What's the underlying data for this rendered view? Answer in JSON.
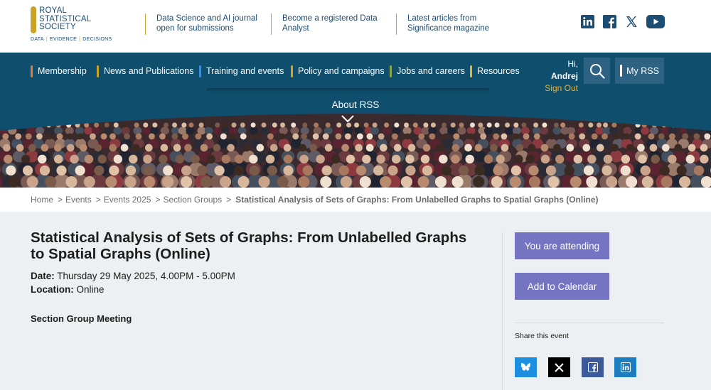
{
  "logo": {
    "lines": [
      "ROYAL",
      "STATISTICAL",
      "SOCIETY"
    ],
    "tagline": [
      "DATA",
      "EVIDENCE",
      "DECISIONS"
    ]
  },
  "promos": [
    {
      "line1": "Data Science and AI journal",
      "line2": "open for submissions"
    },
    {
      "line1": "Become a registered Data",
      "line2": "Analyst"
    },
    {
      "line1": "Latest articles from",
      "line2": "Significance magazine"
    }
  ],
  "social_top": [
    "linkedin-icon",
    "facebook-icon",
    "x-icon",
    "youtube-icon"
  ],
  "nav": {
    "items": [
      {
        "label": "Membership",
        "color": "#e07b39"
      },
      {
        "label": "News and Publications",
        "color": "#c9a227"
      },
      {
        "label": "Training and events",
        "color": "#3a8fd8"
      },
      {
        "label": "Policy and campaigns",
        "color": "#d4a22a"
      },
      {
        "label": "Jobs and careers",
        "color": "#8aa64a"
      },
      {
        "label": "Resources",
        "color": "#e0b33a"
      }
    ],
    "greeting": "Hi,",
    "user_name": "Andrej",
    "sign_out": "Sign Out",
    "my_rss": "My RSS"
  },
  "hero": {
    "about_label": "About RSS"
  },
  "breadcrumb": {
    "items": [
      "Home",
      "Events",
      "Events 2025",
      "Section Groups"
    ],
    "current": "Statistical Analysis of Sets of Graphs: From Unlabelled Graphs to Spatial Graphs (Online)"
  },
  "event": {
    "title": "Statistical Analysis of Sets of Graphs: From Unlabelled Graphs to Spatial Graphs (Online)",
    "date_label": "Date:",
    "date_value": "Thursday 29 May 2025, 4.00PM - 5.00PM",
    "location_label": "Location:",
    "location_value": "Online",
    "type": "Section Group Meeting"
  },
  "sidebar": {
    "attending_label": "You are attending",
    "calendar_label": "Add to Calendar",
    "share_label": "Share this event",
    "share_icons": [
      "bluesky-icon",
      "x-icon",
      "facebook-icon",
      "linkedin-icon"
    ]
  },
  "colors": {
    "nav_bg": "#0f4e6c",
    "accent_gold": "#c9a227",
    "button_purple": "#7474c2",
    "page_bg": "#ecf0f2"
  }
}
